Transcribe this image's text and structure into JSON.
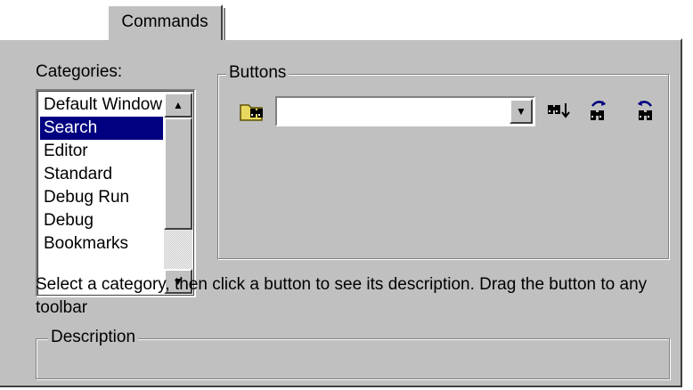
{
  "tab": {
    "label": "Commands"
  },
  "categories": {
    "label": "Categories:",
    "items": [
      "Default Window",
      "Search",
      "Editor",
      "Standard",
      "Debug Run",
      "Debug",
      "Bookmarks"
    ],
    "selected": "Search"
  },
  "buttons_group": {
    "title": "Buttons",
    "find_combo_value": "",
    "icons": [
      "find-in-files-icon",
      "find-next-icon",
      "find-previous-icon",
      "find-replace-icon"
    ]
  },
  "hint_text": "Select a category, then click a button to see its description. Drag the button to any toolbar",
  "description": {
    "title": "Description",
    "text": ""
  },
  "colors": {
    "face": "#c0c0c0",
    "selection": "#000080",
    "shadow": "#808080",
    "highlight": "#ffffff"
  }
}
